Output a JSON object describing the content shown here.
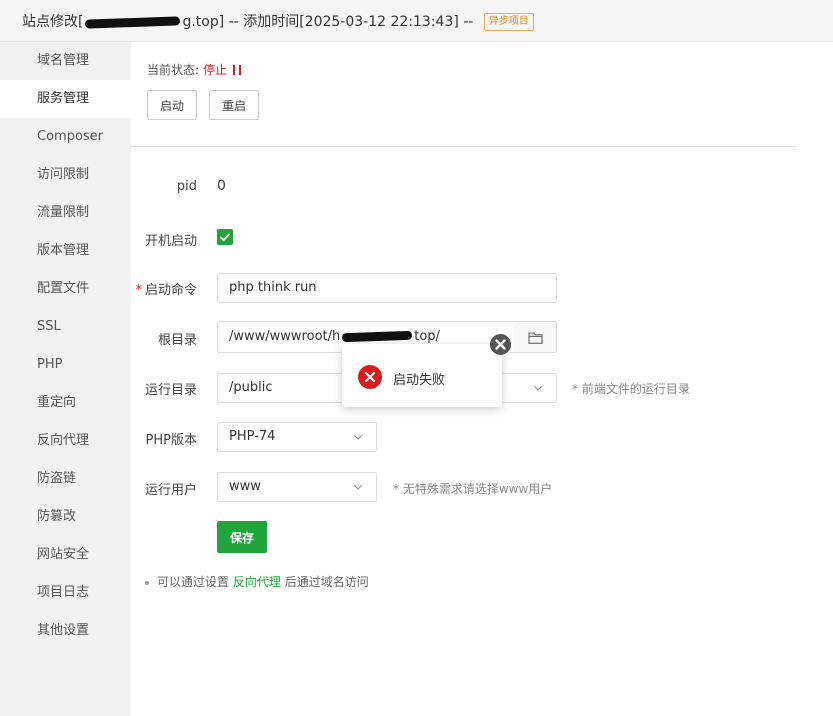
{
  "window": {
    "title": "站点修改[",
    "title_suffix": "g.top] -- 添加时间[2025-03-12 22:13:43] --",
    "badge": "异步项目"
  },
  "sidebar": {
    "items": [
      {
        "label": "域名管理"
      },
      {
        "label": "服务管理"
      },
      {
        "label": "Composer"
      },
      {
        "label": "访问限制"
      },
      {
        "label": "流量限制"
      },
      {
        "label": "版本管理"
      },
      {
        "label": "配置文件"
      },
      {
        "label": "SSL"
      },
      {
        "label": "PHP"
      },
      {
        "label": "重定向"
      },
      {
        "label": "反向代理"
      },
      {
        "label": "防盗链"
      },
      {
        "label": "防篡改"
      },
      {
        "label": "网站安全"
      },
      {
        "label": "项目日志"
      },
      {
        "label": "其他设置"
      }
    ],
    "active_index": 1
  },
  "service": {
    "status_label": "当前状态:",
    "status_value": "停止",
    "start_button": "启动",
    "restart_button": "重启"
  },
  "form": {
    "pid_label": "pid",
    "pid_value": "0",
    "autostart_label": "开机启动",
    "autostart_checked": true,
    "command_label": "启动命令",
    "command_value": "php think run",
    "root_label": "根目录",
    "root_value_prefix": "/www/wwwroot/h",
    "root_value_suffix": "top/",
    "run_dir_label": "运行目录",
    "run_dir_value": "/public",
    "run_dir_hint": "* 前端文件的运行目录",
    "php_version_label": "PHP版本",
    "php_version_value": "PHP-74",
    "run_user_label": "运行用户",
    "run_user_value": "www",
    "run_user_hint": "* 无特殊需求请选择www用户",
    "save_button": "保存"
  },
  "note": {
    "prefix": "可以通过设置",
    "link": "反向代理",
    "suffix": "后通过域名访问"
  },
  "toast": {
    "message": "启动失败"
  },
  "colors": {
    "accent": "#20a53a",
    "error": "#e0191f",
    "badge": "#f0ad4e"
  }
}
